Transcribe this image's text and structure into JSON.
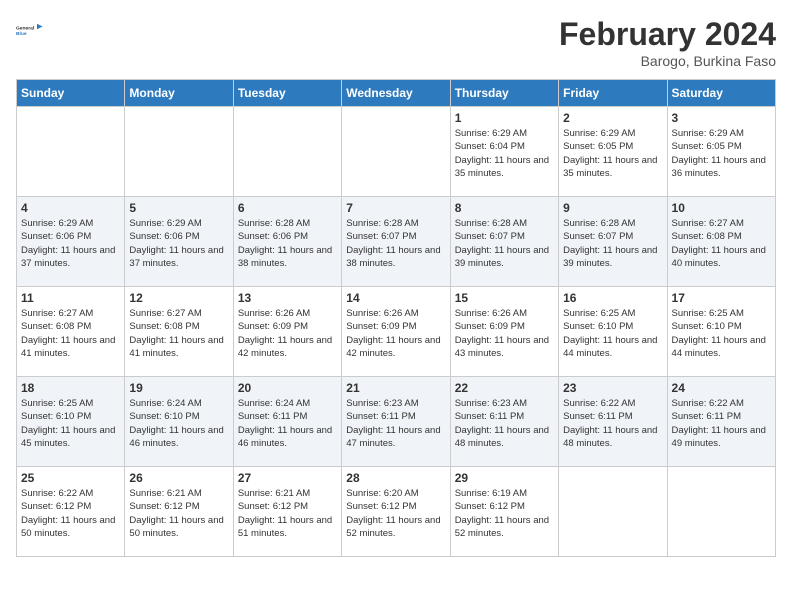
{
  "header": {
    "logo_general": "General",
    "logo_blue": "Blue",
    "month_year": "February 2024",
    "location": "Barogo, Burkina Faso"
  },
  "weekdays": [
    "Sunday",
    "Monday",
    "Tuesday",
    "Wednesday",
    "Thursday",
    "Friday",
    "Saturday"
  ],
  "weeks": [
    [
      {
        "day": "",
        "sunrise": "",
        "sunset": "",
        "daylight": "",
        "empty": true
      },
      {
        "day": "",
        "sunrise": "",
        "sunset": "",
        "daylight": "",
        "empty": true
      },
      {
        "day": "",
        "sunrise": "",
        "sunset": "",
        "daylight": "",
        "empty": true
      },
      {
        "day": "",
        "sunrise": "",
        "sunset": "",
        "daylight": "",
        "empty": true
      },
      {
        "day": "1",
        "sunrise": "Sunrise: 6:29 AM",
        "sunset": "Sunset: 6:04 PM",
        "daylight": "Daylight: 11 hours and 35 minutes.",
        "empty": false
      },
      {
        "day": "2",
        "sunrise": "Sunrise: 6:29 AM",
        "sunset": "Sunset: 6:05 PM",
        "daylight": "Daylight: 11 hours and 35 minutes.",
        "empty": false
      },
      {
        "day": "3",
        "sunrise": "Sunrise: 6:29 AM",
        "sunset": "Sunset: 6:05 PM",
        "daylight": "Daylight: 11 hours and 36 minutes.",
        "empty": false
      }
    ],
    [
      {
        "day": "4",
        "sunrise": "Sunrise: 6:29 AM",
        "sunset": "Sunset: 6:06 PM",
        "daylight": "Daylight: 11 hours and 37 minutes.",
        "empty": false
      },
      {
        "day": "5",
        "sunrise": "Sunrise: 6:29 AM",
        "sunset": "Sunset: 6:06 PM",
        "daylight": "Daylight: 11 hours and 37 minutes.",
        "empty": false
      },
      {
        "day": "6",
        "sunrise": "Sunrise: 6:28 AM",
        "sunset": "Sunset: 6:06 PM",
        "daylight": "Daylight: 11 hours and 38 minutes.",
        "empty": false
      },
      {
        "day": "7",
        "sunrise": "Sunrise: 6:28 AM",
        "sunset": "Sunset: 6:07 PM",
        "daylight": "Daylight: 11 hours and 38 minutes.",
        "empty": false
      },
      {
        "day": "8",
        "sunrise": "Sunrise: 6:28 AM",
        "sunset": "Sunset: 6:07 PM",
        "daylight": "Daylight: 11 hours and 39 minutes.",
        "empty": false
      },
      {
        "day": "9",
        "sunrise": "Sunrise: 6:28 AM",
        "sunset": "Sunset: 6:07 PM",
        "daylight": "Daylight: 11 hours and 39 minutes.",
        "empty": false
      },
      {
        "day": "10",
        "sunrise": "Sunrise: 6:27 AM",
        "sunset": "Sunset: 6:08 PM",
        "daylight": "Daylight: 11 hours and 40 minutes.",
        "empty": false
      }
    ],
    [
      {
        "day": "11",
        "sunrise": "Sunrise: 6:27 AM",
        "sunset": "Sunset: 6:08 PM",
        "daylight": "Daylight: 11 hours and 41 minutes.",
        "empty": false
      },
      {
        "day": "12",
        "sunrise": "Sunrise: 6:27 AM",
        "sunset": "Sunset: 6:08 PM",
        "daylight": "Daylight: 11 hours and 41 minutes.",
        "empty": false
      },
      {
        "day": "13",
        "sunrise": "Sunrise: 6:26 AM",
        "sunset": "Sunset: 6:09 PM",
        "daylight": "Daylight: 11 hours and 42 minutes.",
        "empty": false
      },
      {
        "day": "14",
        "sunrise": "Sunrise: 6:26 AM",
        "sunset": "Sunset: 6:09 PM",
        "daylight": "Daylight: 11 hours and 42 minutes.",
        "empty": false
      },
      {
        "day": "15",
        "sunrise": "Sunrise: 6:26 AM",
        "sunset": "Sunset: 6:09 PM",
        "daylight": "Daylight: 11 hours and 43 minutes.",
        "empty": false
      },
      {
        "day": "16",
        "sunrise": "Sunrise: 6:25 AM",
        "sunset": "Sunset: 6:10 PM",
        "daylight": "Daylight: 11 hours and 44 minutes.",
        "empty": false
      },
      {
        "day": "17",
        "sunrise": "Sunrise: 6:25 AM",
        "sunset": "Sunset: 6:10 PM",
        "daylight": "Daylight: 11 hours and 44 minutes.",
        "empty": false
      }
    ],
    [
      {
        "day": "18",
        "sunrise": "Sunrise: 6:25 AM",
        "sunset": "Sunset: 6:10 PM",
        "daylight": "Daylight: 11 hours and 45 minutes.",
        "empty": false
      },
      {
        "day": "19",
        "sunrise": "Sunrise: 6:24 AM",
        "sunset": "Sunset: 6:10 PM",
        "daylight": "Daylight: 11 hours and 46 minutes.",
        "empty": false
      },
      {
        "day": "20",
        "sunrise": "Sunrise: 6:24 AM",
        "sunset": "Sunset: 6:11 PM",
        "daylight": "Daylight: 11 hours and 46 minutes.",
        "empty": false
      },
      {
        "day": "21",
        "sunrise": "Sunrise: 6:23 AM",
        "sunset": "Sunset: 6:11 PM",
        "daylight": "Daylight: 11 hours and 47 minutes.",
        "empty": false
      },
      {
        "day": "22",
        "sunrise": "Sunrise: 6:23 AM",
        "sunset": "Sunset: 6:11 PM",
        "daylight": "Daylight: 11 hours and 48 minutes.",
        "empty": false
      },
      {
        "day": "23",
        "sunrise": "Sunrise: 6:22 AM",
        "sunset": "Sunset: 6:11 PM",
        "daylight": "Daylight: 11 hours and 48 minutes.",
        "empty": false
      },
      {
        "day": "24",
        "sunrise": "Sunrise: 6:22 AM",
        "sunset": "Sunset: 6:11 PM",
        "daylight": "Daylight: 11 hours and 49 minutes.",
        "empty": false
      }
    ],
    [
      {
        "day": "25",
        "sunrise": "Sunrise: 6:22 AM",
        "sunset": "Sunset: 6:12 PM",
        "daylight": "Daylight: 11 hours and 50 minutes.",
        "empty": false
      },
      {
        "day": "26",
        "sunrise": "Sunrise: 6:21 AM",
        "sunset": "Sunset: 6:12 PM",
        "daylight": "Daylight: 11 hours and 50 minutes.",
        "empty": false
      },
      {
        "day": "27",
        "sunrise": "Sunrise: 6:21 AM",
        "sunset": "Sunset: 6:12 PM",
        "daylight": "Daylight: 11 hours and 51 minutes.",
        "empty": false
      },
      {
        "day": "28",
        "sunrise": "Sunrise: 6:20 AM",
        "sunset": "Sunset: 6:12 PM",
        "daylight": "Daylight: 11 hours and 52 minutes.",
        "empty": false
      },
      {
        "day": "29",
        "sunrise": "Sunrise: 6:19 AM",
        "sunset": "Sunset: 6:12 PM",
        "daylight": "Daylight: 11 hours and 52 minutes.",
        "empty": false
      },
      {
        "day": "",
        "sunrise": "",
        "sunset": "",
        "daylight": "",
        "empty": true
      },
      {
        "day": "",
        "sunrise": "",
        "sunset": "",
        "daylight": "",
        "empty": true
      }
    ]
  ]
}
